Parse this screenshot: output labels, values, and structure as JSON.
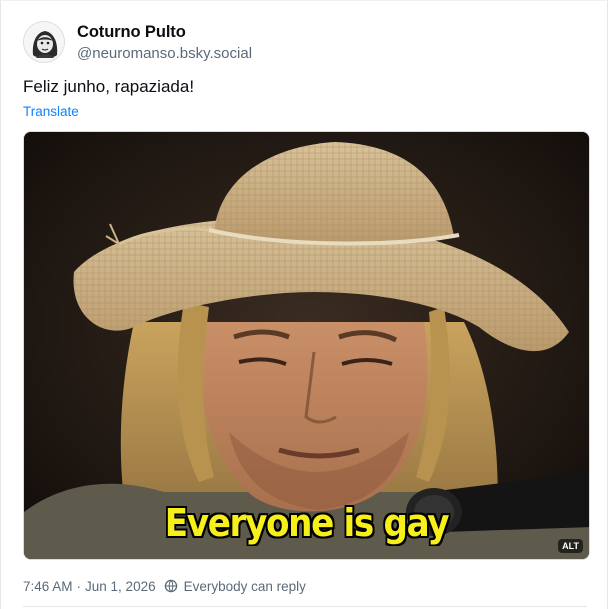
{
  "author": {
    "display_name": "Coturno Pulto",
    "handle": "@neuromanso.bsky.social"
  },
  "post": {
    "text": "Feliz junho, rapaziada!",
    "translate_label": "Translate"
  },
  "media": {
    "caption": "Everyone is gay",
    "alt_badge": "ALT"
  },
  "meta": {
    "time": "7:46 AM",
    "separator": "·",
    "date": "Jun 1, 2026",
    "reply_setting": "Everybody can reply",
    "reply_icon": "globe-reply-icon"
  },
  "colors": {
    "link": "#1083fe",
    "muted": "#5b6a78",
    "caption": "#f7ef1a"
  }
}
